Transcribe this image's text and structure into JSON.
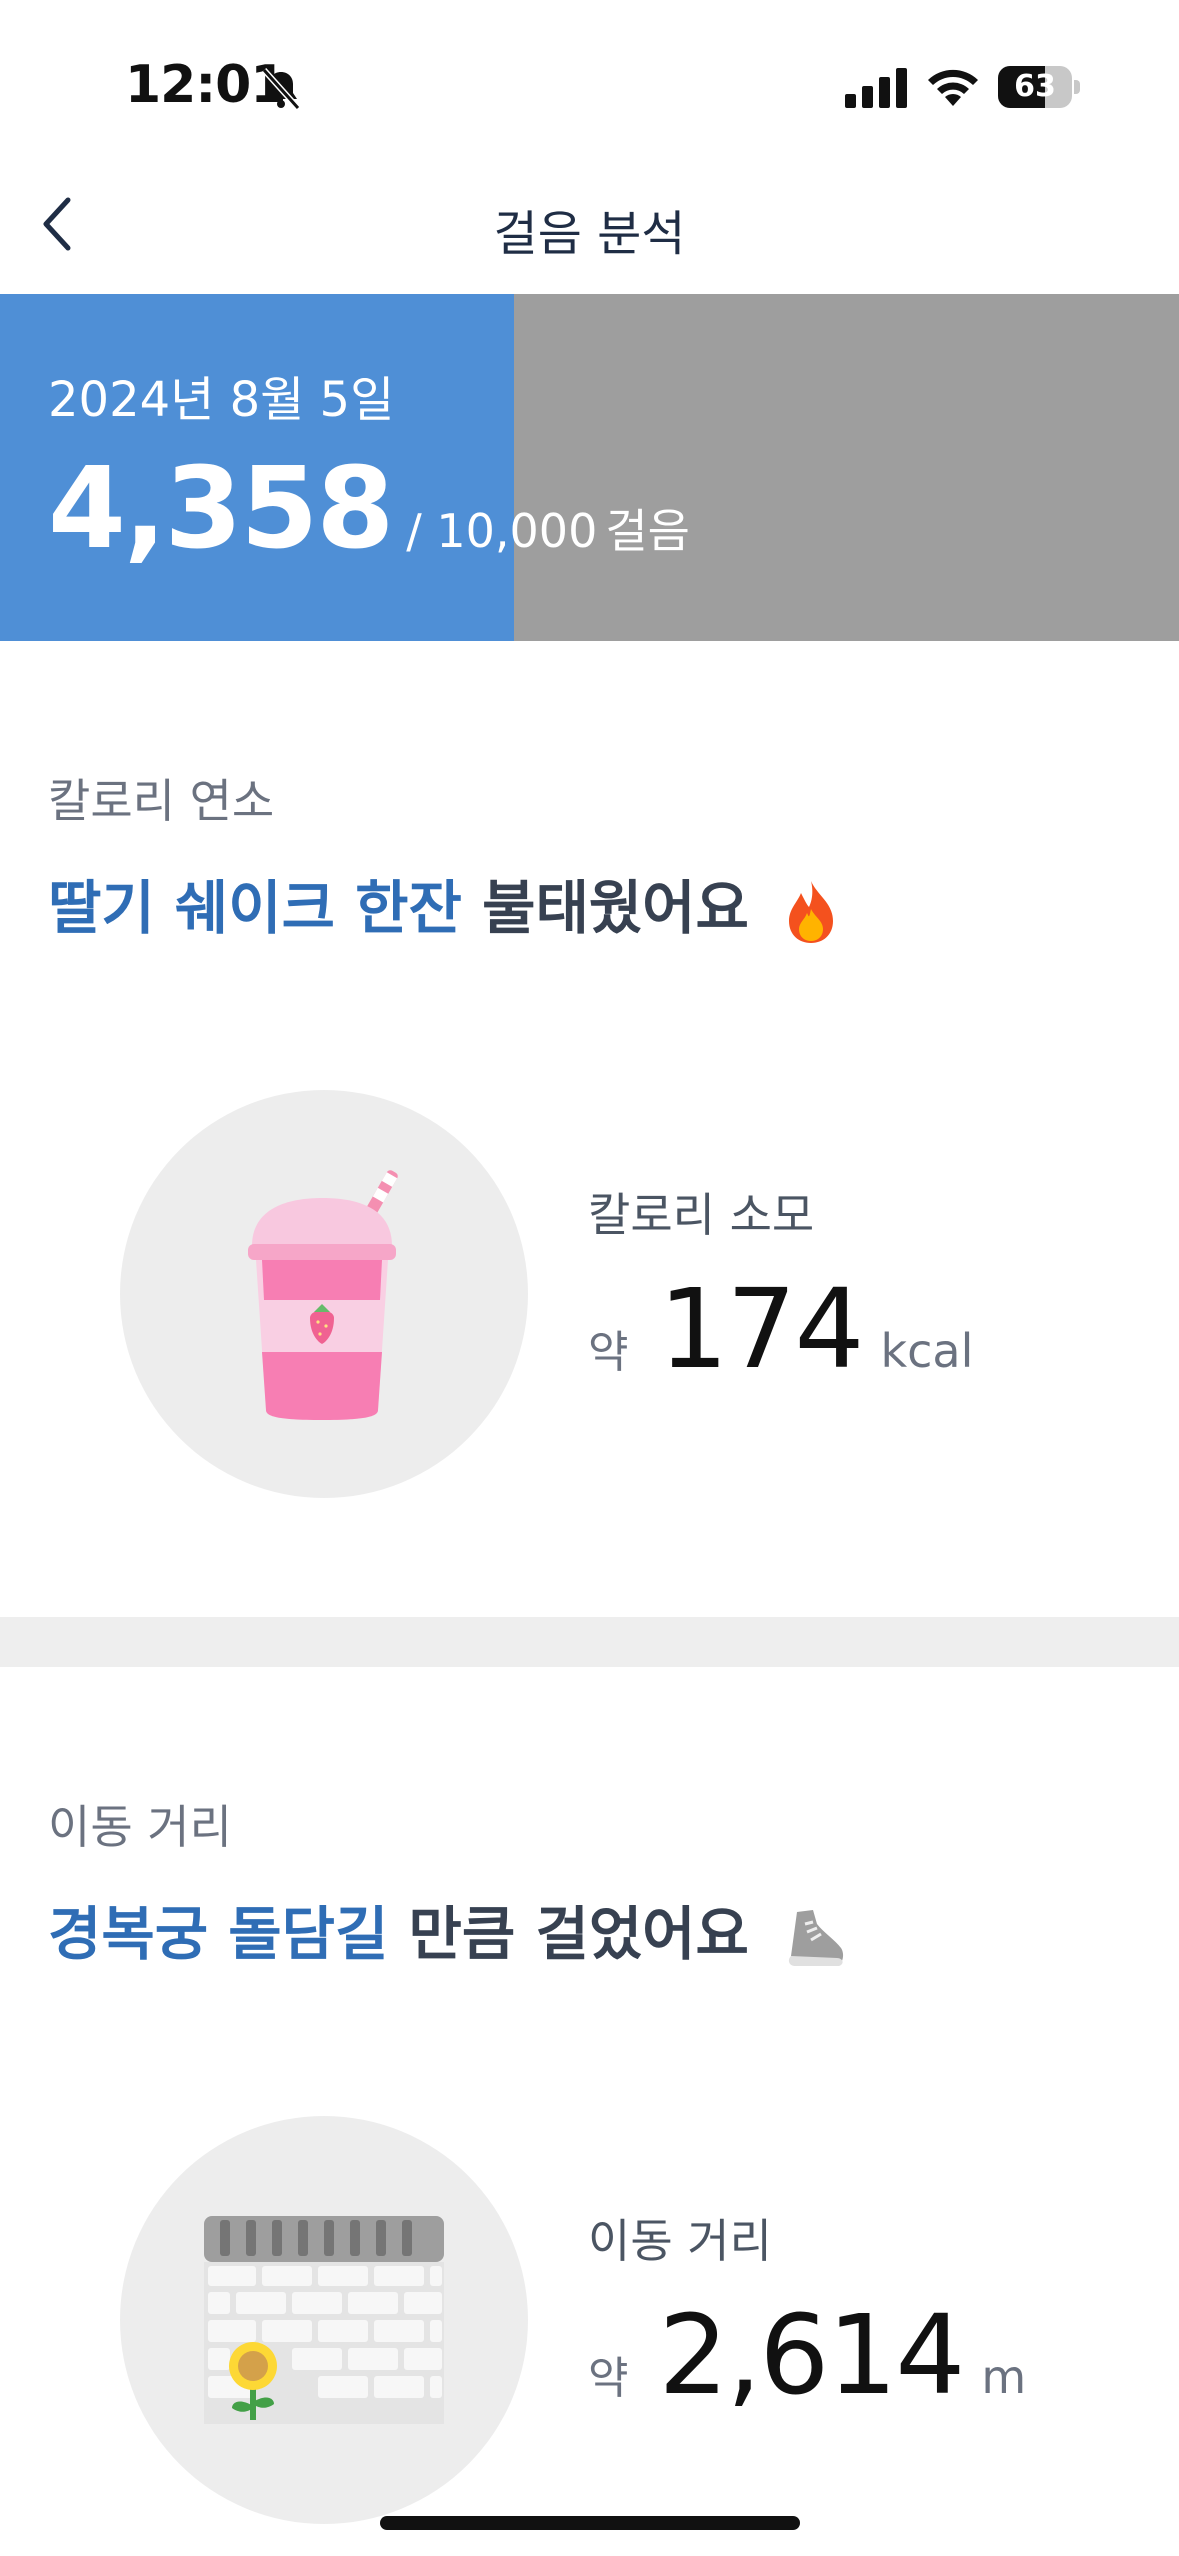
{
  "status_bar": {
    "time": "12:01",
    "battery_level": 63,
    "battery_text": "63",
    "icons": [
      "bell-slash-icon",
      "cellular-signal-icon",
      "wifi-icon",
      "battery-icon"
    ]
  },
  "nav": {
    "back_icon": "chevron-left-icon",
    "title": "걸음 분석"
  },
  "progress": {
    "date": "2024년 8월 5일",
    "steps": "4,358",
    "goal": "/ 10,000",
    "unit": "걸음",
    "fraction": 0.4358,
    "colors": {
      "fill": "#4f8fd6",
      "track": "#9e9e9e"
    }
  },
  "calorie_section": {
    "label": "칼로리 연소",
    "headline_accent": "딸기 쉐이크 한잔",
    "headline_rest": " 불태웠어요",
    "emoji_icon": "fire-icon",
    "illustration": "strawberry-shake-icon",
    "metric_label": "칼로리 소모",
    "prefix": "약",
    "value": "174",
    "unit": "kcal"
  },
  "distance_section": {
    "label": "이동 거리",
    "headline_accent": "경복궁 돌담길",
    "headline_rest": " 만큼 걸었어요",
    "emoji_icon": "sneaker-icon",
    "illustration": "stone-wall-sunflower-icon",
    "metric_label": "이동 거리",
    "prefix": "약",
    "value": "2,614",
    "unit": "m"
  }
}
